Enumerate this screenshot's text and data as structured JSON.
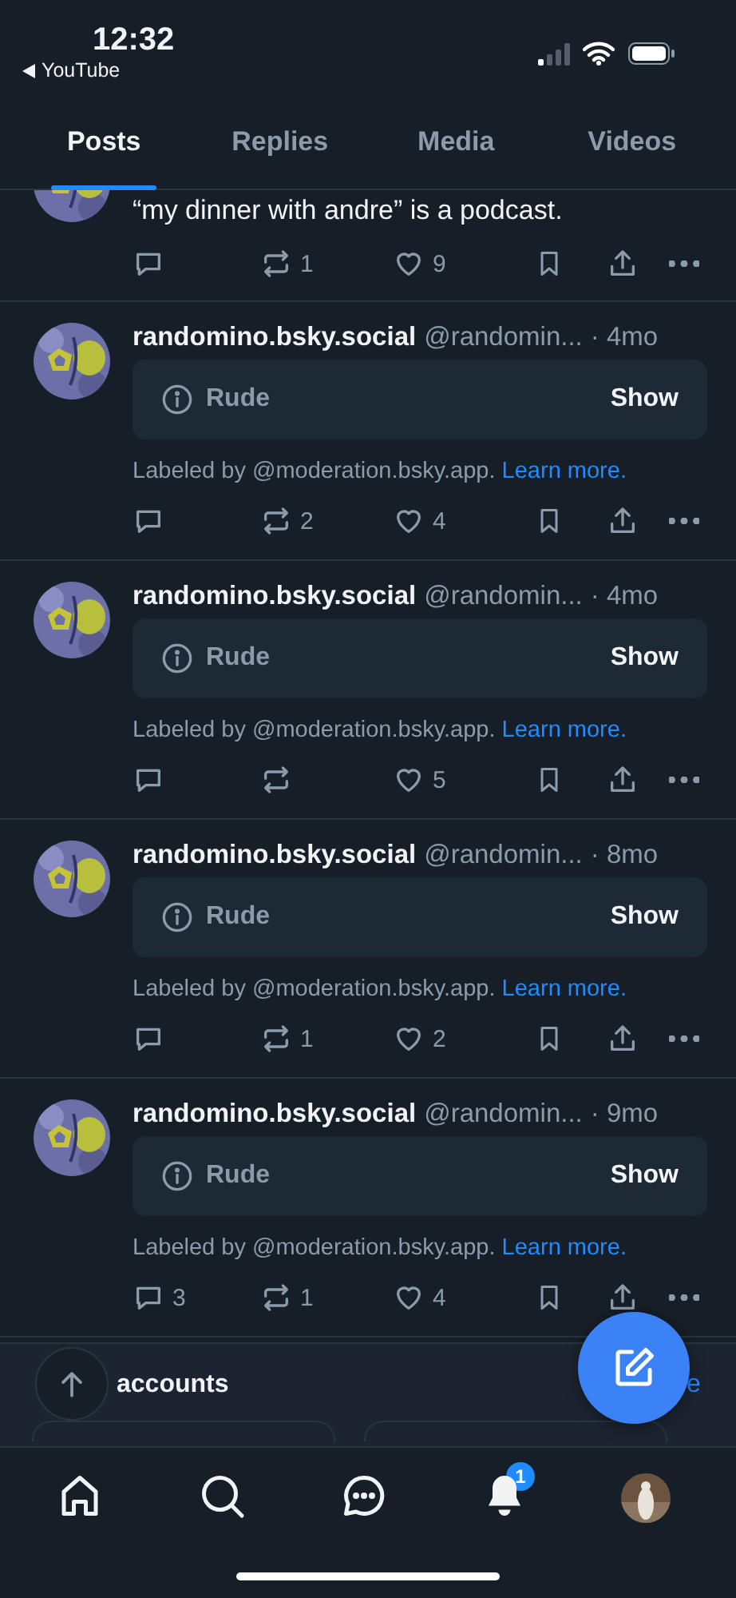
{
  "status_bar": {
    "time": "12:32",
    "back_app": "YouTube"
  },
  "tabs": [
    {
      "label": "Posts",
      "selected": true
    },
    {
      "label": "Replies",
      "selected": false
    },
    {
      "label": "Media",
      "selected": false
    },
    {
      "label": "Videos",
      "selected": false
    }
  ],
  "partial_post": {
    "text": "“my dinner with andre” is a podcast.",
    "reposts": "1",
    "likes": "9"
  },
  "posts": [
    {
      "name": "randomino.bsky.social",
      "handle": "@randomin...",
      "time": "· 4mo",
      "label": "Rude",
      "show": "Show",
      "labeled_by": "Labeled by @moderation.bsky.app.",
      "learn_more": "Learn more.",
      "reposts": "2",
      "likes": "4"
    },
    {
      "name": "randomino.bsky.social",
      "handle": "@randomin...",
      "time": "· 4mo",
      "label": "Rude",
      "show": "Show",
      "labeled_by": "Labeled by @moderation.bsky.app.",
      "learn_more": "Learn more.",
      "likes": "5"
    },
    {
      "name": "randomino.bsky.social",
      "handle": "@randomin...",
      "time": "· 8mo",
      "label": "Rude",
      "show": "Show",
      "labeled_by": "Labeled by @moderation.bsky.app.",
      "learn_more": "Learn more.",
      "reposts": "1",
      "likes": "2"
    },
    {
      "name": "randomino.bsky.social",
      "handle": "@randomin...",
      "time": "· 9mo",
      "label": "Rude",
      "show": "Show",
      "labeled_by": "Labeled by @moderation.bsky.app.",
      "learn_more": "Learn more.",
      "replies": "3",
      "reposts": "1",
      "likes": "4"
    }
  ],
  "suggested": {
    "title": "accounts",
    "link": "e"
  },
  "nav": {
    "notification_badge": "1"
  }
}
